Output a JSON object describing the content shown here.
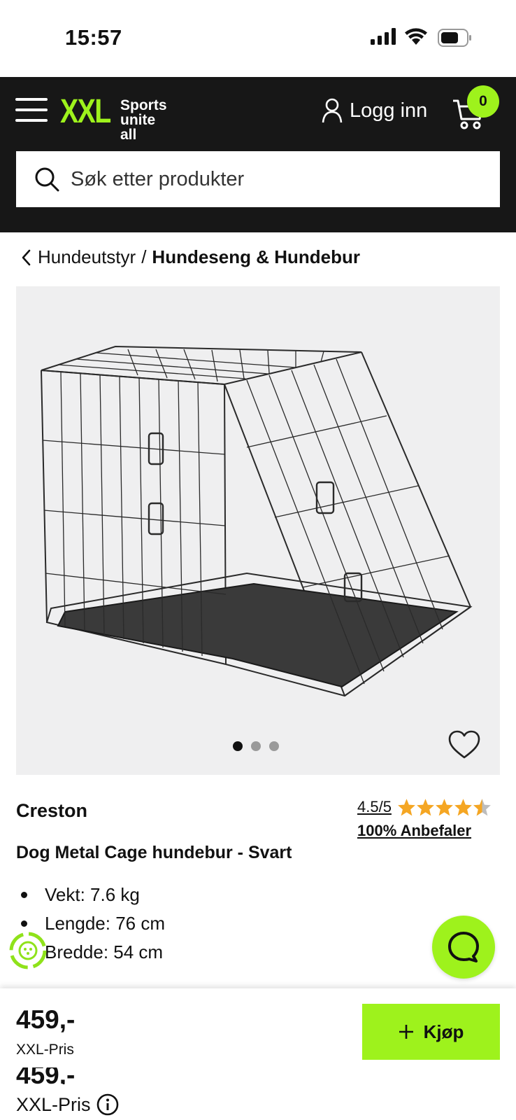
{
  "status_bar": {
    "time": "15:57"
  },
  "header": {
    "logo_text": "XXL",
    "logo_tagline_line1": "Sports",
    "logo_tagline_line2": "unite all",
    "login_label": "Logg inn",
    "cart_count": "0",
    "search_placeholder": "Søk etter produkter"
  },
  "breadcrumb": {
    "parent": "Hundeutstyr",
    "separator": "/",
    "current": "Hundeseng & Hundebur"
  },
  "gallery": {
    "image_count": 3,
    "active_index": 0
  },
  "product": {
    "brand": "Creston",
    "rating_text": "4.5/5",
    "rating_value": 4.5,
    "rating_max": 5,
    "recommend_text": "100% Anbefaler",
    "title": "Dog Metal Cage hundebur - Svart",
    "specs": [
      "Vekt: 7.6 kg",
      "Lengde: 76 cm",
      "Bredde: 54 cm"
    ]
  },
  "buy_bar": {
    "price": "459,-",
    "price_label": "XXL-Pris",
    "price_repeat": "459,-",
    "price_label_repeat": "XXL-Pris",
    "buy_label": "Kjøp"
  },
  "colors": {
    "accent": "#9ef21c",
    "header_bg": "#171717",
    "star": "#f5a623"
  },
  "icons": [
    "menu-icon",
    "user-icon",
    "cart-icon",
    "search-icon",
    "chevron-left-icon",
    "heart-icon",
    "star-icon",
    "chat-icon",
    "recycle-icon",
    "plus-icon",
    "info-icon"
  ]
}
